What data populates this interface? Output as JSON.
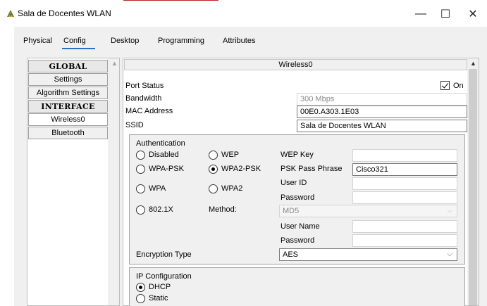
{
  "window": {
    "title": "Sala de Docentes WLAN",
    "min_glyph": "—",
    "max_glyph": "☐",
    "close_glyph": "✕",
    "icon": "packet-tracer-icon"
  },
  "tabs": [
    {
      "label": "Physical"
    },
    {
      "label": "Config"
    },
    {
      "label": "Desktop"
    },
    {
      "label": "Programming"
    },
    {
      "label": "Attributes"
    }
  ],
  "active_tab": "Config",
  "sidebar": {
    "items": [
      {
        "label": "GLOBAL"
      },
      {
        "label": "Settings"
      },
      {
        "label": "Algorithm Settings"
      },
      {
        "label": "INTERFACE"
      },
      {
        "label": "Wireless0"
      },
      {
        "label": "Bluetooth"
      }
    ]
  },
  "panel": {
    "header": "Wireless0",
    "port_status_label": "Port Status",
    "port_status_on_label": "On",
    "port_status_on": true,
    "bandwidth_label": "Bandwidth",
    "bandwidth_value": "300 Mbps",
    "mac_label": "MAC Address",
    "mac_value": "00E0.A303.1E03",
    "ssid_label": "SSID",
    "ssid_value": "Sala de Docentes WLAN"
  },
  "auth": {
    "group_label": "Authentication",
    "options": {
      "disabled": "Disabled",
      "wep": "WEP",
      "wpa_psk": "WPA-PSK",
      "wpa2_psk": "WPA2-PSK",
      "wpa": "WPA",
      "wpa2": "WPA2",
      "dot1x": "802.1X"
    },
    "selected": "WPA2-PSK",
    "method_label": "Method:",
    "wep_key_label": "WEP Key",
    "wep_key_value": "",
    "psk_label": "PSK Pass Phrase",
    "psk_value": "Cisco321",
    "user_id_label": "User ID",
    "user_id_value": "",
    "password_label": "Password",
    "password_value": "",
    "method_value": "MD5",
    "user_name_label": "User Name",
    "user_name_value": "",
    "password2_label": "Password",
    "password2_value": "",
    "encryption_label": "Encryption Type",
    "encryption_value": "AES"
  },
  "ip": {
    "group_label": "IP Configuration",
    "dhcp_label": "DHCP",
    "static_label": "Static",
    "selected": "DHCP"
  }
}
